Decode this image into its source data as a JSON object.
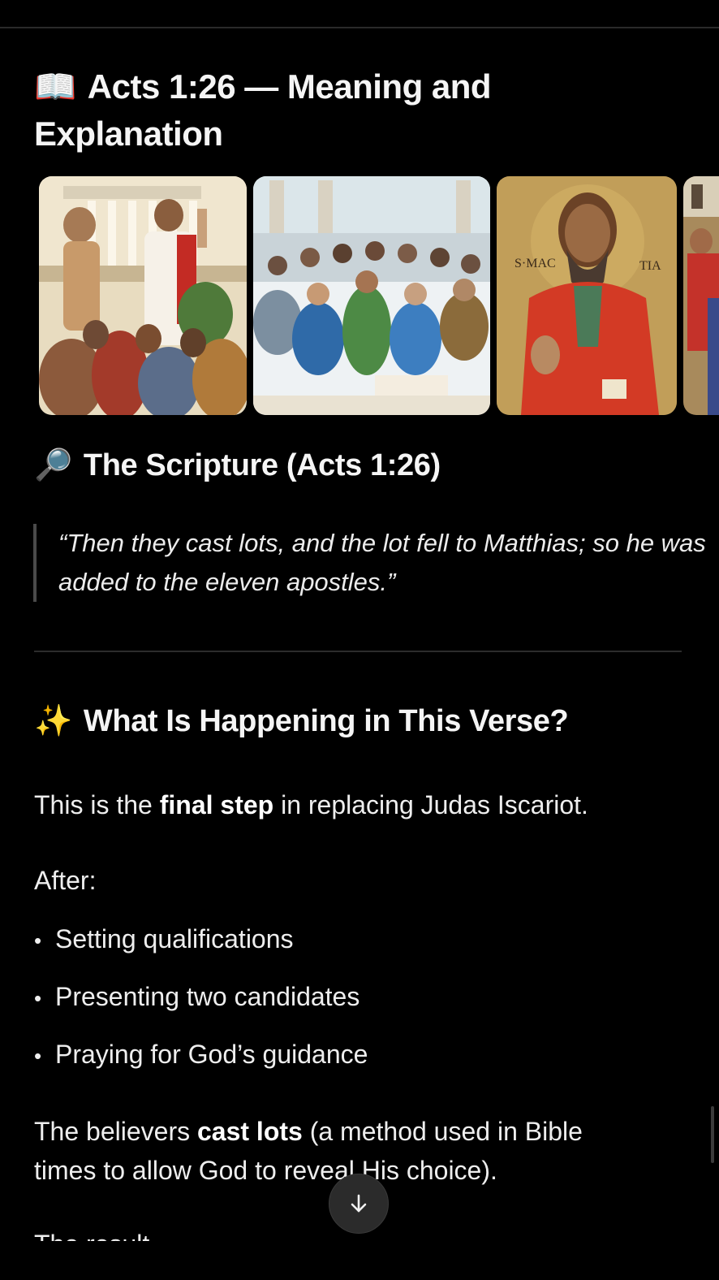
{
  "article": {
    "title_emoji": "📖",
    "title": "Acts 1:26 — Meaning and Explanation",
    "scripture_section": {
      "emoji": "🔎",
      "heading": "The Scripture (Acts 1:26)",
      "quote": "“Then they cast lots, and the lot fell to Matthias; so he was added to the eleven apostles.”"
    },
    "happening_section": {
      "emoji": "✨",
      "heading": "What Is Happening in This Verse?",
      "intro_before": "This is the ",
      "intro_bold": "final step",
      "intro_after": " in replacing Judas Iscariot.",
      "after_label": "After:",
      "bullets": [
        "Setting qualifications",
        "Presenting two candidates",
        "Praying for God’s guidance"
      ],
      "lots_before": "The believers ",
      "lots_bold": "cast lots",
      "lots_after": " (a method used in Bible times to allow God to reveal His choice).",
      "cut_text": "The result"
    }
  },
  "gallery": {
    "images": [
      {
        "name": "apostle preaching to crowd painting"
      },
      {
        "name": "disciples praying together painting"
      },
      {
        "name": "icon of saint matthias"
      },
      {
        "name": "partial painting"
      }
    ]
  },
  "colors": {
    "background": "#000000",
    "text": "#f2f2f2",
    "quote_bar": "#4a4a4a"
  },
  "controls": {
    "scroll_down_icon": "arrow-down-icon"
  }
}
